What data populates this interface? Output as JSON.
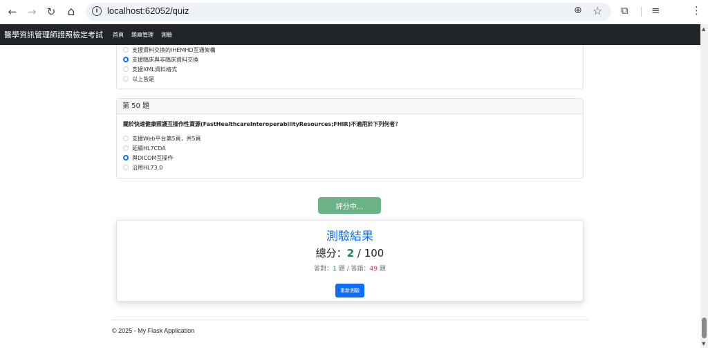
{
  "browser": {
    "url": "localhost:62052/quiz",
    "back_icon": "←",
    "forward_icon": "→",
    "reload_icon": "↻",
    "home_icon": "⌂",
    "zoom_icon": "⊕",
    "star_icon": "☆",
    "extensions_icon": "⧉",
    "media_icon": "≡",
    "menu_icon": "⋮"
  },
  "navbar": {
    "brand": "醫學資訊管理師證照檢定考試",
    "links": [
      "首頁",
      "題庫管理",
      "測驗"
    ]
  },
  "prev_question": {
    "options": [
      "支援資料交換的IHEMHD互通架構",
      "支援臨床與非臨床資料交換",
      "支援XML資料格式",
      "以上皆是"
    ]
  },
  "question_50": {
    "header": "第 50 題",
    "text": "關於快速健康照護互操作性資源(FastHealthcareInteroperabilityResources;FHIR)不適用於下列何者？",
    "options": [
      "支援Web平台第5頁，共5頁",
      "延續HL7CDA",
      "與DICOM互操作",
      "沿用HL73.0"
    ]
  },
  "submit_button": "評分中...",
  "result": {
    "title": "測驗結果",
    "score_label": "總分：",
    "score": "2",
    "score_total": "/ 100",
    "correct_label": "答對：",
    "correct": "1",
    "correct_unit": "題 / 答錯：",
    "wrong": "49",
    "wrong_unit": "題",
    "restart_button": "重新測驗"
  },
  "footer": "© 2025 - My Flask Application"
}
